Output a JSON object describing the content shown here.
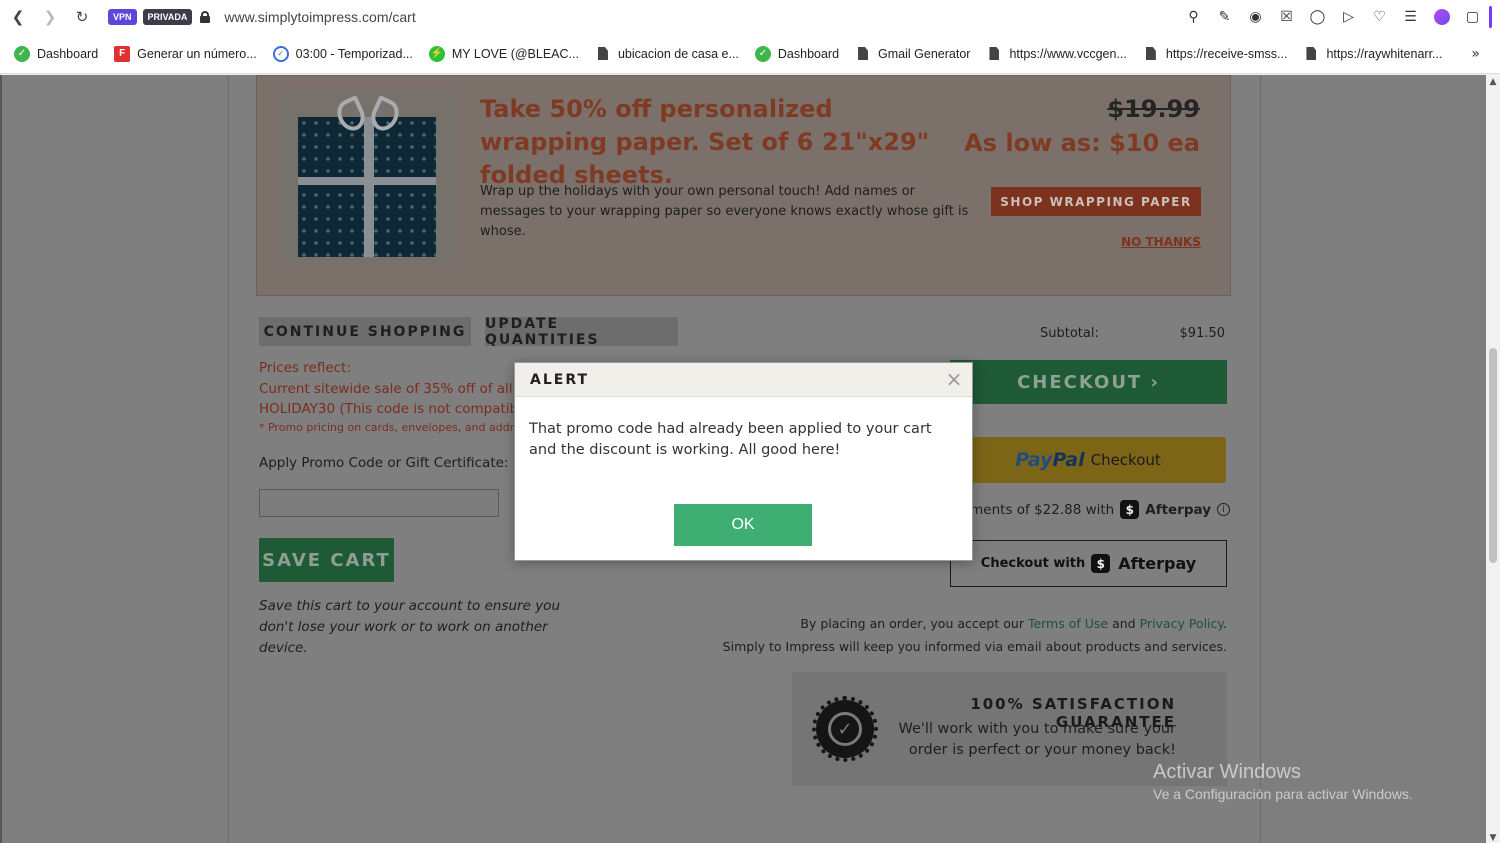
{
  "browser": {
    "vpn_badge": "VPN",
    "private_badge": "PRIVADA",
    "url": "www.simplytoimpress.com/cart",
    "toolbar_icons": [
      "zoom-icon",
      "share-icon",
      "camera-icon",
      "shield-icon",
      "globe-icon",
      "send-icon",
      "heart-icon",
      "menu-icon",
      "profile-icon",
      "extensions-icon"
    ]
  },
  "bookmarks": [
    {
      "label": "Dashboard",
      "icon": "green-check-icon"
    },
    {
      "label": "Generar un número...",
      "icon": "f-logo-icon"
    },
    {
      "label": "03:00 - Temporizad...",
      "icon": "clock-icon"
    },
    {
      "label": "MY LOVE (@BLEAC...",
      "icon": "bolt-icon"
    },
    {
      "label": "ubicacion de casa e...",
      "icon": "document-icon"
    },
    {
      "label": "Dashboard",
      "icon": "green-check-icon"
    },
    {
      "label": "Gmail Generator",
      "icon": "document-icon"
    },
    {
      "label": "https://www.vccgen...",
      "icon": "document-icon"
    },
    {
      "label": "https://receive-smss...",
      "icon": "document-icon"
    },
    {
      "label": "https://raywhitenarr...",
      "icon": "document-icon"
    }
  ],
  "promo": {
    "title": "Take 50% off personalized wrapping paper. Set of 6 21\"x29\" folded sheets.",
    "description": "Wrap up the holidays with your own personal touch! Add names or messages to your wrapping paper so everyone knows exactly whose gift is whose.",
    "old_price": "$19.99",
    "low_price": "As low as: $10 ea",
    "shop_button": "SHOP WRAPPING PAPER",
    "no_thanks": "NO THANKS"
  },
  "cart": {
    "continue_shopping": "CONTINUE SHOPPING",
    "update_quantities": "UPDATE QUANTITIES",
    "subtotal_label": "Subtotal:",
    "subtotal_value": "$91.50",
    "checkout": "CHECKOUT ›",
    "paypal_brand_pay": "Pay",
    "paypal_brand_pal": "Pal",
    "paypal_checkout": "Checkout",
    "afterpay_line": "ayments of $22.88 with",
    "afterpay_brand": "Afterpay",
    "afterpay_checkout_prefix": "Checkout with",
    "afterpay_checkout_brand": "Afterpay",
    "prices_reflect_1": "Prices reflect:",
    "prices_reflect_2": "Current sitewide sale of 35% off of all pr",
    "prices_reflect_3": "HOLIDAY30 (This code is not compatible",
    "prices_note": "* Promo pricing on cards, envelopes, and addre",
    "promo_label": "Apply Promo Code or Gift Certificate:",
    "promo_value": "",
    "save_cart": "SAVE CART",
    "save_note": "Save this cart to your account to ensure you don't lose your work or to work on another device.",
    "terms_prefix": "By placing an order, you accept our",
    "terms_link": "Terms of Use",
    "terms_and": "and",
    "privacy_link": "Privacy Policy",
    "terms_suffix": ".",
    "informed": "Simply to Impress will keep you informed via email about products and services.",
    "guarantee_title": "100% SATISFACTION GUARANTEE",
    "guarantee_text": "We'll work with you to make sure your order is perfect or your money back!"
  },
  "watermark": {
    "line1": "Activar Windows",
    "line2": "Ve a Configuración para activar Windows."
  },
  "modal": {
    "title": "ALERT",
    "close": "×",
    "message": "That promo code had already been applied to your cart and the discount is working. All good here!",
    "ok": "OK"
  }
}
